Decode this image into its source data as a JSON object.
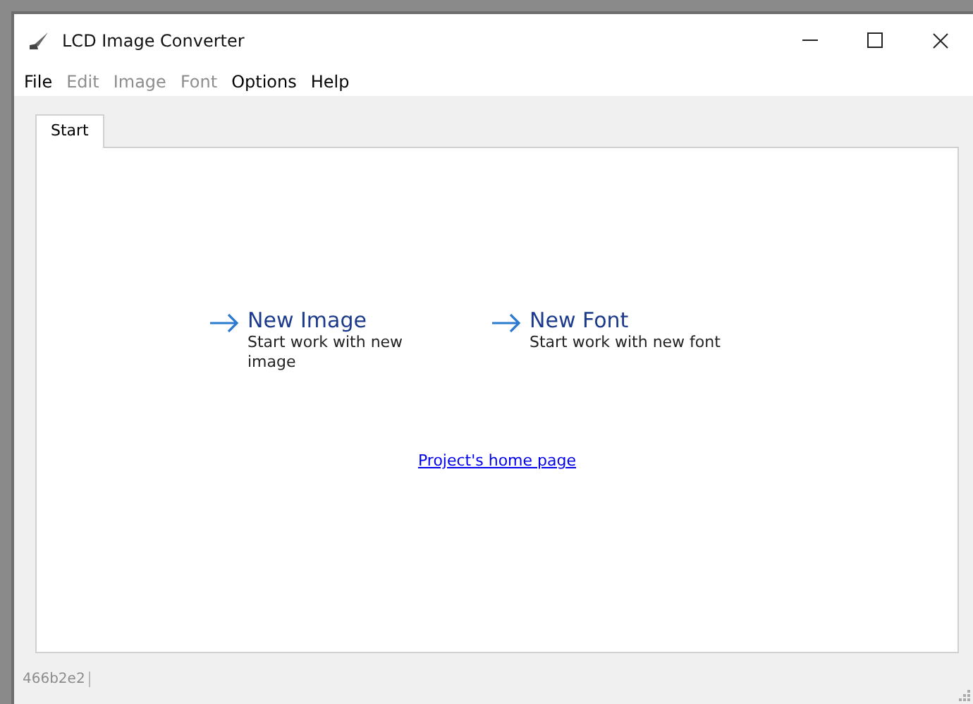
{
  "window": {
    "title": "LCD Image Converter"
  },
  "menu": [
    {
      "label": "File",
      "disabled": false
    },
    {
      "label": "Edit",
      "disabled": true
    },
    {
      "label": "Image",
      "disabled": true
    },
    {
      "label": "Font",
      "disabled": true
    },
    {
      "label": "Options",
      "disabled": false
    },
    {
      "label": "Help",
      "disabled": false
    }
  ],
  "tabs": [
    {
      "label": "Start",
      "selected": true
    }
  ],
  "actions": [
    {
      "title": "New Image",
      "description": "Start work with new image"
    },
    {
      "title": "New Font",
      "description": "Start work with new font"
    }
  ],
  "home_link": "Project's home page",
  "status_bar": "466b2e2"
}
